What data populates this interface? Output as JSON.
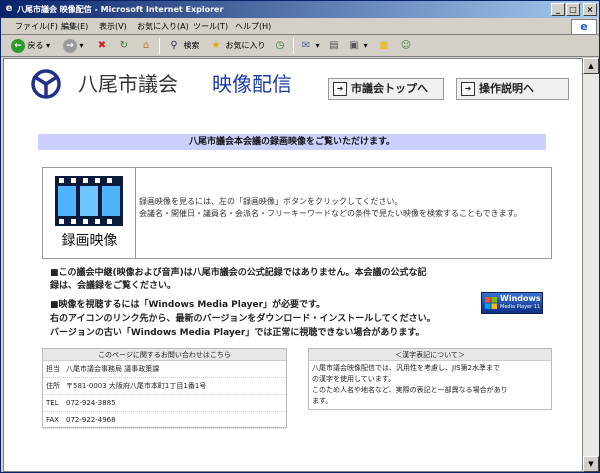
{
  "window": {
    "title": "八尾市議会 映像配信 - Microsoft Internet Explorer"
  },
  "menubar": {
    "items": [
      "ファイル(F)",
      "編集(E)",
      "表示(V)",
      "お気に入り(A)",
      "ツール(T)",
      "ヘルプ(H)"
    ]
  },
  "toolbar": {
    "back_label": "戻る",
    "search_label": "検索",
    "favorites_label": "お気に入り"
  },
  "page": {
    "site_title": "八尾市議会",
    "site_subtitle": "映像配信",
    "nav_top_label": "市議会トップへ",
    "nav_help_label": "操作説明へ",
    "banner": "八尾市議会本会議の録画映像をご覧いただけます。",
    "video_button_label": "録画映像",
    "video_desc_1": "録画映像を見るには、左の「録画映像」ボタンをクリックしてください。",
    "video_desc_2": "会議名・開催日・議員名・会派名・フリーキーワードなどの条件で見たい映像を検索することもできます。",
    "notice_1a": "■この議会中継(映像および音声)は八尾市議会の公式記録ではありません。本会議の公式な記",
    "notice_1b": "録は、会議録をご覧ください。",
    "notice_2a": "■映像を視聴するには「Windows Media Player」が必要です。",
    "notice_2b": "右のアイコンのリンク先から、最新のバージョンをダウンロード・インストールしてください。",
    "notice_2c": "バージョンの古い「Windows Media Player」では正常に視聴できない場合があります。",
    "wmp_line1": "Windows",
    "wmp_line2": "Media Player 11"
  },
  "contact": {
    "heading": "このページに関するお問い合わせはこちら",
    "rows": [
      {
        "k": "担当",
        "v": "八尾市議会事務局 議事政策課"
      },
      {
        "k": "住所",
        "v": "〒581-0003 大阪府八尾市本町1丁目1番1号"
      },
      {
        "k": "TEL",
        "v": "072-924-3885"
      },
      {
        "k": "FAX",
        "v": "072-922-4968"
      }
    ]
  },
  "kanji_note": {
    "heading": "＜漢字表記について＞",
    "text_1": "八尾市議会映像配信では、汎用性を考慮し、JIS第2水準まで",
    "text_2": "の漢字を使用しています。",
    "text_3": "このため人名や地名など、実際の表記と一部異なる場合があり",
    "text_4": "ます。"
  },
  "colors": {
    "banner_bg": "#ccd0ff",
    "title_accent": "#1a3aa6",
    "titlebar": "#0a246a"
  }
}
